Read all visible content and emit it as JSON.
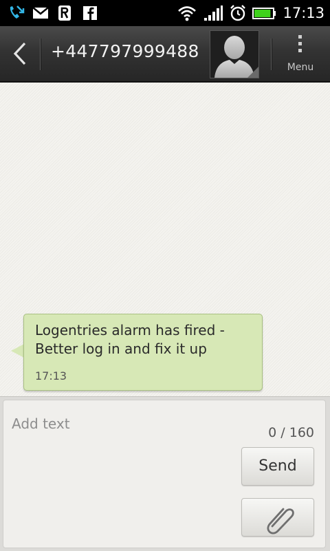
{
  "status_bar": {
    "time": "17:13",
    "left_icons": [
      "missed-call-icon",
      "gmail-icon",
      "r-app-icon",
      "facebook-icon"
    ],
    "right_icons": [
      "wifi-icon",
      "signal-icon",
      "alarm-icon",
      "battery-icon"
    ],
    "battery_level": 0.9
  },
  "header": {
    "title": "+447797999488",
    "menu_label": "Menu"
  },
  "messages": [
    {
      "text": "Logentries alarm has fired - Better log in and fix it up",
      "time": "17:13"
    }
  ],
  "compose": {
    "placeholder": "Add text",
    "char_count": "0 / 160",
    "send_label": "Send"
  },
  "colors": {
    "bubble": "#d7e8b6",
    "header": "#333333",
    "background": "#f3f2ee"
  }
}
